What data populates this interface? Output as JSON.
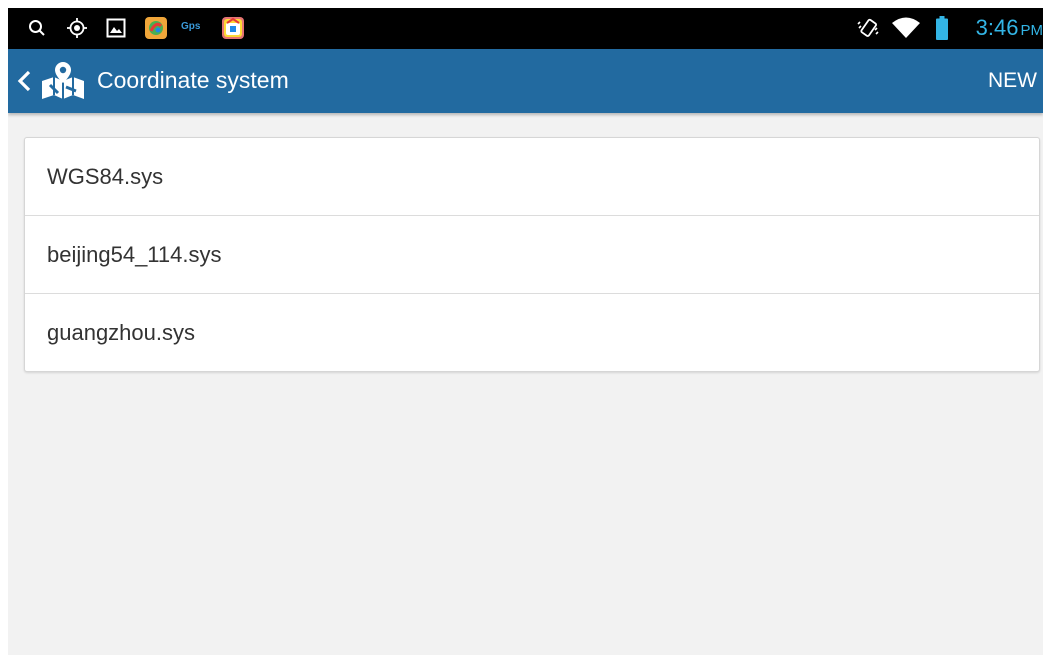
{
  "status_bar": {
    "gps_label": "Gps",
    "time": "3:46",
    "ampm": "PM",
    "icons": [
      "search-icon",
      "location-target-icon",
      "gallery-icon",
      "app-icon",
      "gps-icon",
      "store-icon",
      "vibrate-icon",
      "wifi-icon",
      "battery-icon"
    ]
  },
  "action_bar": {
    "title": "Coordinate system",
    "new_label": "NEW",
    "colors": {
      "background": "#226aa0",
      "text": "#ffffff"
    }
  },
  "files": [
    {
      "name": "WGS84.sys"
    },
    {
      "name": "beijing54_114.sys"
    },
    {
      "name": "guangzhou.sys"
    }
  ],
  "colors": {
    "status_bar_bg": "#000000",
    "time_color": "#33b5e5",
    "page_bg": "#f2f2f2",
    "card_bg": "#ffffff"
  }
}
